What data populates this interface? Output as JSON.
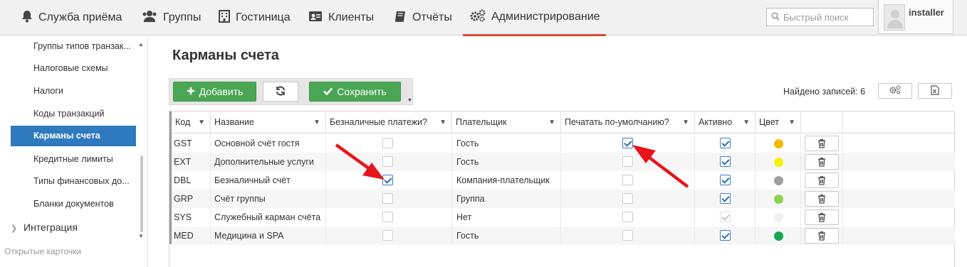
{
  "nav": {
    "items": [
      {
        "label": "Служба приёма"
      },
      {
        "label": "Группы"
      },
      {
        "label": "Гостиница"
      },
      {
        "label": "Клиенты"
      },
      {
        "label": "Отчёты"
      },
      {
        "label": "Администрирование"
      }
    ],
    "active": "Администрирование",
    "search_placeholder": "Быстрый поиск",
    "user": "installer"
  },
  "sidebar": {
    "items": [
      {
        "label": "Группы типов транзак..."
      },
      {
        "label": "Налоговые схемы"
      },
      {
        "label": "Налоги"
      },
      {
        "label": "Коды транзакций"
      },
      {
        "label": "Карманы счета",
        "active": true
      },
      {
        "label": "Кредитные лимиты"
      },
      {
        "label": "Типы финансовых до..."
      },
      {
        "label": "Бланки документов"
      }
    ],
    "group": "Интеграция",
    "caption": "Открытые карточки"
  },
  "main": {
    "title": "Карманы счета",
    "toolbar": {
      "add_label": "Добавить",
      "save_label": "Сохранить"
    },
    "found_label": "Найдено записей: 6"
  },
  "table": {
    "columns": [
      {
        "label": "Код"
      },
      {
        "label": "Название"
      },
      {
        "label": "Безналичные платежи?"
      },
      {
        "label": "Плательщик"
      },
      {
        "label": "Печатать по-умолчанию?"
      },
      {
        "label": "Активно"
      },
      {
        "label": "Цвет"
      }
    ],
    "rows": [
      {
        "code": "GST",
        "name": "Основной счёт гостя",
        "cashless": false,
        "payer": "Гость",
        "print_default": true,
        "active": true,
        "active_disabled": false,
        "color": "#f5b800"
      },
      {
        "code": "EXT",
        "name": "Дополнительные услуги",
        "cashless": false,
        "payer": "Гость",
        "print_default": false,
        "active": true,
        "active_disabled": false,
        "color": "#f5f10a"
      },
      {
        "code": "DBL",
        "name": "Безналичный счёт",
        "cashless": true,
        "payer": "Компания-плательщик",
        "print_default": false,
        "active": true,
        "active_disabled": false,
        "color": "#9e9e9e"
      },
      {
        "code": "GRP",
        "name": "Счёт группы",
        "cashless": false,
        "payer": "Группа",
        "print_default": false,
        "active": true,
        "active_disabled": false,
        "color": "#8fd14f"
      },
      {
        "code": "SYS",
        "name": "Служебный карман счёта",
        "cashless": false,
        "payer": "Нет",
        "print_default": false,
        "active": true,
        "active_disabled": true,
        "color": "#f0f0f0"
      },
      {
        "code": "MED",
        "name": "Медицина и SPA",
        "cashless": false,
        "payer": "Гость",
        "print_default": false,
        "active": true,
        "active_disabled": false,
        "color": "#12a850"
      }
    ]
  },
  "colors": {
    "accent_blue": "#2f7abf",
    "button_green": "#4aa655",
    "active_tab_underline": "#e04a3a",
    "annotation_arrow": "#e8141b"
  },
  "icons": {
    "nav": [
      "bell-icon",
      "users-icon",
      "building-icon",
      "contact-card-icon",
      "book-icon",
      "gears-icon"
    ],
    "toolbar": [
      "plus-icon",
      "refresh-icon",
      "check-icon"
    ],
    "row_action": "trash-icon"
  }
}
